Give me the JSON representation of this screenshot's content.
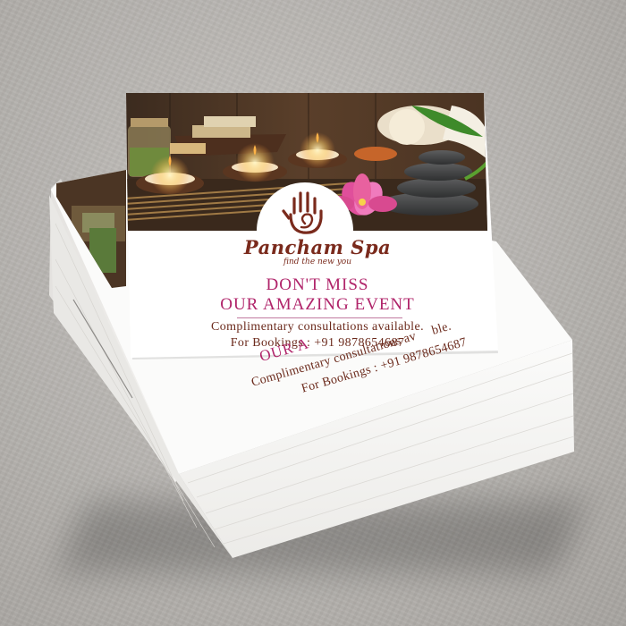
{
  "flyer": {
    "brand": "Pancham Spa",
    "tagline": "find the new you",
    "headline_line1": "DON'T MISS",
    "headline_line2": "OUR AMAZING EVENT",
    "info_line1": "Complimentary consultations available.",
    "info_line2": "For Bookings : +91 9878654687"
  },
  "under_flyer": {
    "headline_fragment": "OUR A",
    "info_line1_fragment": "Complimentary consultations av",
    "info_line1_end": "ble.",
    "info_line2": "For Bookings : +91 9878654687"
  },
  "colors": {
    "headline": "#b0246a",
    "body_text": "#6b2a1c",
    "brand": "#7a2a1c",
    "surface": "#b9b6b2",
    "paper": "#ffffff"
  }
}
